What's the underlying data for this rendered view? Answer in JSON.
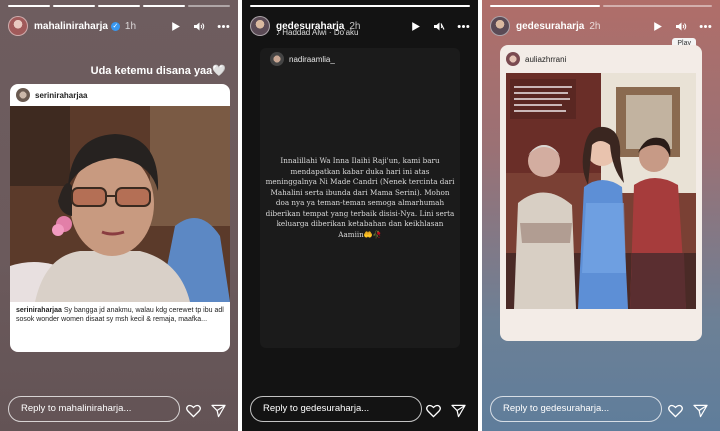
{
  "colors": {
    "verified": "#3897f0",
    "background_1": "#6b5a5c",
    "background_2": "#131313",
    "background_3": "#7a7f96"
  },
  "stories": [
    {
      "username": "mahaliniraharja",
      "verified": true,
      "time": "1h",
      "caption": "Uda ketemu disana yaa🤍",
      "repost": {
        "username": "seriniraharjaa",
        "caption_user": "seriniraharjaa",
        "caption_text": "Sy bangga jd anakmu, walau kdg cerewet tp ibu adl sosok wonder women disaat sy msh kecil & remaja, maafka..."
      },
      "reply_placeholder": "Reply to mahaliniraharja...",
      "controls": [
        "play-icon",
        "mute-icon",
        "more-icon"
      ]
    },
    {
      "username": "gedesuraharja",
      "time": "2h",
      "music": "Haddad Alwi · Do'aku",
      "mention_username": "nadiraamlia_",
      "text": "Innalillahi Wa Inna Ilaihi Raji'un, kami baru mendapatkan kabar duka hari ini atas meninggalnya Ni Made Candri (Nenek tercinta dari Mahalini serta ibunda dari Mama Serini). Mohon doa nya ya teman-teman semoga almarhumah diberikan tempat yang terbaik disisi-Nya. Lini serta keluarga diberikan ketabahan dan keikhlasan Aamiin🤲🥀",
      "reply_placeholder": "Reply to gedesuraharja...",
      "controls": [
        "play-icon",
        "muted-icon",
        "more-icon"
      ]
    },
    {
      "username": "gedesuraharja",
      "time": "2h",
      "repost_username": "auliazhrrani",
      "tooltip": "Play",
      "reply_placeholder": "Reply to gedesuraharja...",
      "controls": [
        "play-icon",
        "mute-icon",
        "more-icon"
      ]
    }
  ]
}
